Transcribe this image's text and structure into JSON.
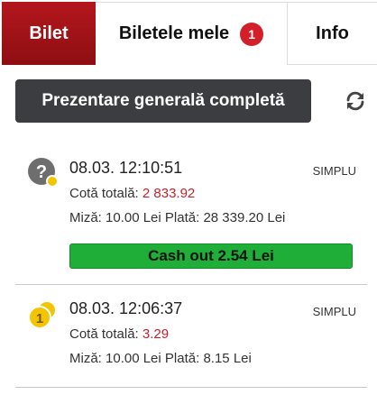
{
  "tabs": {
    "bilet": "Bilet",
    "biletele_mele": "Biletele mele",
    "badge_count": "1",
    "info": "Info"
  },
  "overview_button": "Prezentare generală completă",
  "labels": {
    "total_odds": "Cotă totală:",
    "stake": "Miză:",
    "payout": "Plată:"
  },
  "tickets": [
    {
      "datetime": "08.03. 12:10:51",
      "type": "SIMPLU",
      "total_odds": "2 833.92",
      "stake": "10.00 Lei",
      "payout": "28 339.20 Lei",
      "status_icon": "question-pending-icon",
      "cashout_label": "Cash out 2.54 Lei"
    },
    {
      "datetime": "08.03. 12:06:37",
      "type": "SIMPLU",
      "total_odds": "3.29",
      "stake": "10.00 Lei",
      "payout": "8.15 Lei",
      "status_icon": "coins-icon",
      "icon_number": "1"
    }
  ],
  "colors": {
    "active_tab": "#a3141a",
    "badge": "#d21f2a",
    "overview_button": "#3b3d40",
    "cashout": "#1fae38",
    "odds_value": "#c8202b",
    "coin": "#f2c500"
  }
}
